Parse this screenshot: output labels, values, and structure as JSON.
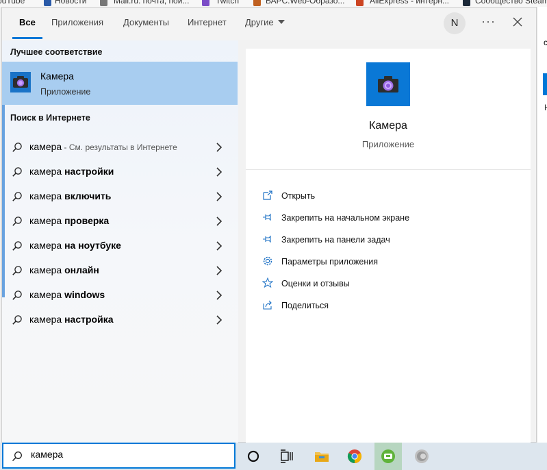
{
  "bookmarks": [
    "ouTube",
    "Новости",
    "Mail.ru: почта, пои...",
    "Twitch",
    "БАРС.Web-Образо...",
    "AliExpress - интерн...",
    "Сообщество Steam"
  ],
  "background_right": {
    "frag1": "са",
    "frag2": "Н"
  },
  "tabs": [
    {
      "label": "Все",
      "active": true
    },
    {
      "label": "Приложения",
      "active": false
    },
    {
      "label": "Документы",
      "active": false
    },
    {
      "label": "Интернет",
      "active": false
    },
    {
      "label": "Другие",
      "active": false
    }
  ],
  "account": {
    "initial": "N"
  },
  "more_label": "···",
  "best_match": {
    "section_title": "Лучшее соответствие",
    "name": "Камера",
    "type": "Приложение"
  },
  "web": {
    "section_title": "Поиск в Интернете",
    "items": [
      {
        "prefix": "камера",
        "bold": "",
        "hint": " - См. результаты в Интернете"
      },
      {
        "prefix": "камера ",
        "bold": "настройки",
        "hint": ""
      },
      {
        "prefix": "камера ",
        "bold": "включить",
        "hint": ""
      },
      {
        "prefix": "камера ",
        "bold": "проверка",
        "hint": ""
      },
      {
        "prefix": "камера ",
        "bold": "на ноутбуке",
        "hint": ""
      },
      {
        "prefix": "камера ",
        "bold": "онлайн",
        "hint": ""
      },
      {
        "prefix": "камера ",
        "bold": "windows",
        "hint": ""
      },
      {
        "prefix": "камера ",
        "bold": "настройка",
        "hint": ""
      }
    ]
  },
  "preview": {
    "name": "Камера",
    "type": "Приложение",
    "actions": [
      {
        "label": "Открыть",
        "icon": "open-icon"
      },
      {
        "label": "Закрепить на начальном экране",
        "icon": "pin-icon"
      },
      {
        "label": "Закрепить на панели задач",
        "icon": "pin-icon"
      },
      {
        "label": "Параметры приложения",
        "icon": "gear-icon"
      },
      {
        "label": "Оценки и отзывы",
        "icon": "star-icon"
      },
      {
        "label": "Поделиться",
        "icon": "share-icon"
      }
    ]
  },
  "taskbar": {
    "search_value": "камера",
    "apps": [
      "cortana-icon",
      "task-view-icon",
      "file-explorer-icon",
      "chrome-icon",
      "app-icon",
      "speaker-app-icon"
    ]
  },
  "colors": {
    "accent": "#0078d7",
    "selection": "#a8cdf0",
    "tile": "#0a78d6"
  }
}
